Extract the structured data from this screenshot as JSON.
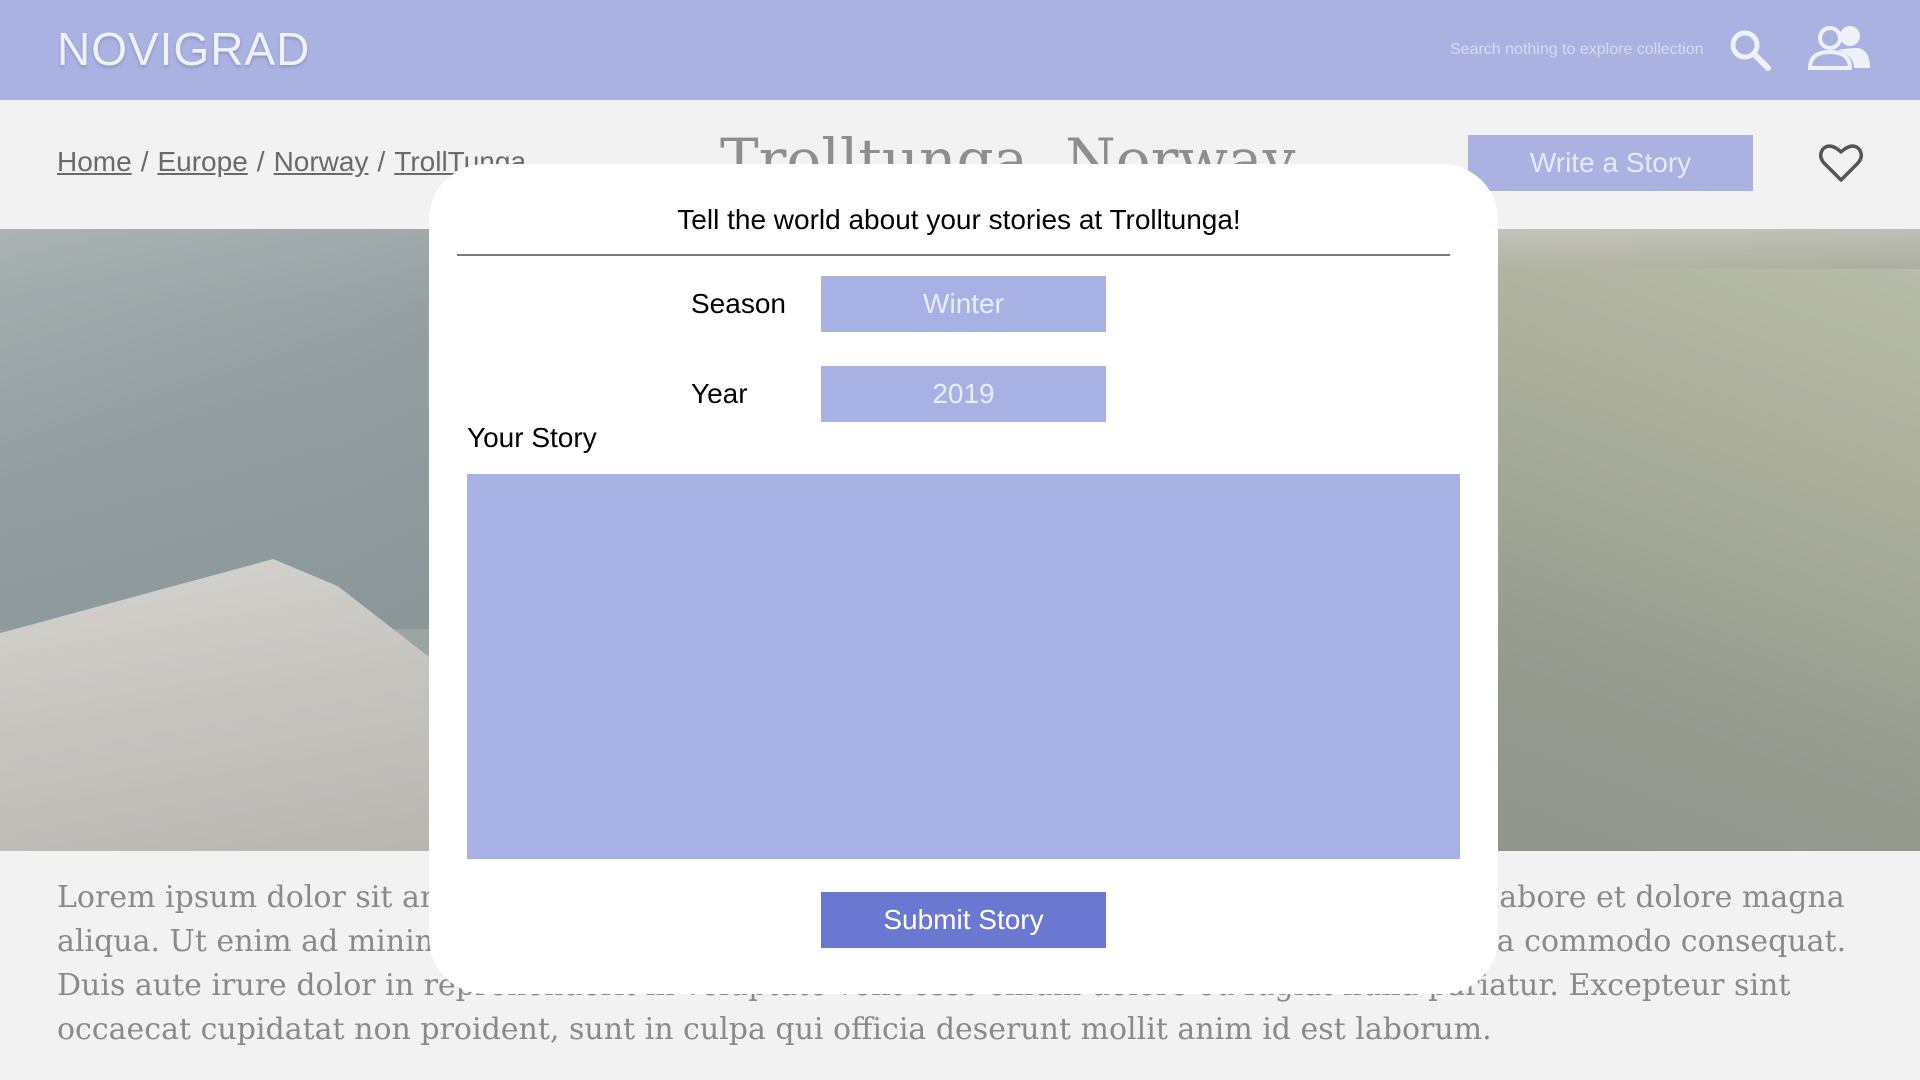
{
  "header": {
    "logo": "NOVIGRAD",
    "search_hint": "Search nothing to explore collection",
    "icons": [
      "search-icon",
      "users-icon"
    ]
  },
  "breadcrumb": [
    "Home",
    "Europe",
    "Norway",
    "TrollTunga"
  ],
  "page_title": "Trolltunga, Norway",
  "write_button": "Write a Story",
  "lorem": "Lorem ipsum dolor sit amet, consectetur adipiscing elit, sed do eiusmod tempor incididunt ut labore et dolore magna aliqua. Ut enim ad minim veniam, quis nostrud exercitation ullamco laboris nisi ut aliquip ex ea commodo consequat. Duis aute irure dolor in reprehenderit in voluptate velit esse cillum dolore eu fugiat nulla pariatur. Excepteur sint occaecat cupidatat non proident, sunt in culpa qui officia deserunt mollit anim id est laborum.",
  "modal": {
    "title": "Tell the world about your stories at Trolltunga!",
    "season_label": "Season",
    "season_value": "Winter",
    "year_label": "Year",
    "year_value": "2019",
    "story_label": "Your Story",
    "story_value": "",
    "submit_label": "Submit Story"
  },
  "colors": {
    "header_bg": "#aab2e2",
    "field_bg": "#a7b1e3",
    "submit_bg": "#6a78d1"
  }
}
